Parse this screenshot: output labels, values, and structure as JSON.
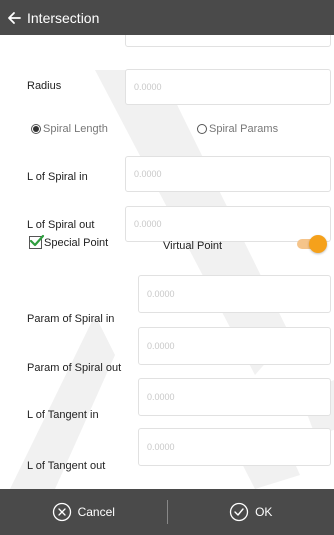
{
  "header": {
    "title": "Intersection"
  },
  "form": {
    "radius": {
      "label": "Radius",
      "placeholder": "0.0000"
    },
    "spiral_mode": {
      "option_length": "Spiral Length",
      "option_params": "Spiral Params",
      "selected": "Spiral Length"
    },
    "l_spiral_in": {
      "label": "L of Spiral in",
      "placeholder": "0.0000"
    },
    "l_spiral_out": {
      "label": "L of Spiral out",
      "placeholder": "0.0000"
    },
    "special_point": {
      "label": "Special Point",
      "checked": true
    },
    "virtual_point": {
      "label": "Virtual Point",
      "on": true
    },
    "param_spiral_in": {
      "label": "Param of Spiral in",
      "placeholder": "0.0000"
    },
    "param_spiral_out": {
      "label": "Param of Spiral out",
      "placeholder": "0.0000"
    },
    "l_tangent_in": {
      "label": "L of Tangent in",
      "placeholder": "0.0000"
    },
    "l_tangent_out": {
      "label": "L of Tangent out",
      "placeholder": "0.0000"
    }
  },
  "footer": {
    "cancel_label": "Cancel",
    "ok_label": "OK"
  },
  "colors": {
    "bar": "#4a4a4a",
    "accent": "#f5a11b",
    "check": "#2e9e3e"
  }
}
